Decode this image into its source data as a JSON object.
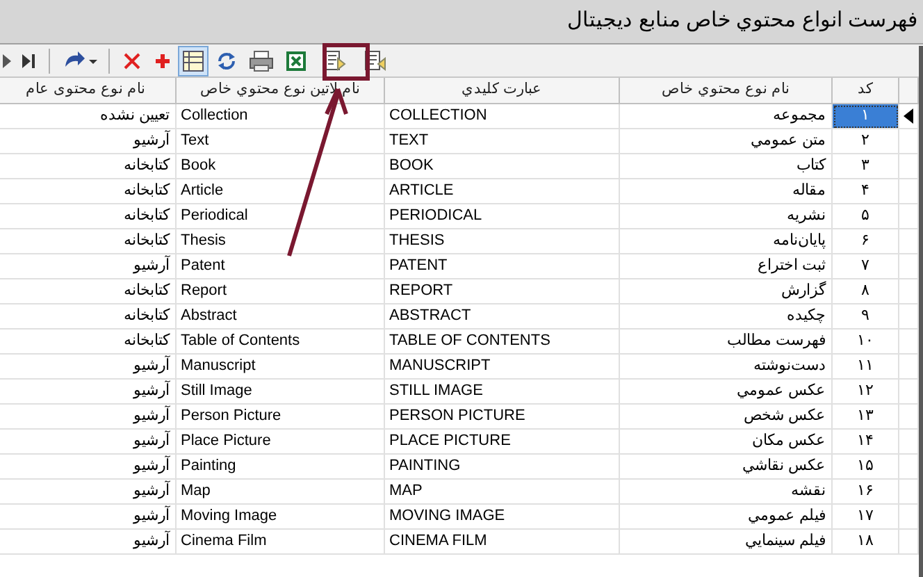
{
  "window": {
    "title": "فهرست انواع محتوي خاص منابع ديجيتال"
  },
  "toolbar": [
    {
      "kind": "next",
      "pressed": false
    },
    {
      "kind": "last",
      "pressed": false
    },
    {
      "kind": "redo",
      "pressed": false
    },
    {
      "kind": "delete",
      "pressed": false
    },
    {
      "kind": "add",
      "pressed": false
    },
    {
      "kind": "grid",
      "pressed": true
    },
    {
      "kind": "refresh",
      "pressed": false
    },
    {
      "kind": "print",
      "pressed": false
    },
    {
      "kind": "excel",
      "pressed": false
    },
    {
      "kind": "export",
      "pressed": false
    },
    {
      "kind": "import",
      "pressed": false
    }
  ],
  "table": {
    "columns": [
      "کد",
      "نام نوع محتوي خاص",
      "عبارت کليدي",
      "نام لاتین نوع محتوي خاص",
      "نام نوع محتوی عام"
    ],
    "rows": [
      {
        "code": "۱",
        "name": "مجموعه",
        "keyword": "COLLECTION",
        "latin": "Collection",
        "general": "تعیین نشده",
        "selected": true
      },
      {
        "code": "۲",
        "name": "متن عمومي",
        "keyword": "TEXT",
        "latin": "Text",
        "general": "آرشیو",
        "selected": false
      },
      {
        "code": "۳",
        "name": "کتاب",
        "keyword": "BOOK",
        "latin": "Book",
        "general": "کتابخانه",
        "selected": false
      },
      {
        "code": "۴",
        "name": "مقاله",
        "keyword": "ARTICLE",
        "latin": "Article",
        "general": "کتابخانه",
        "selected": false
      },
      {
        "code": "۵",
        "name": "نشريه",
        "keyword": "PERIODICAL",
        "latin": "Periodical",
        "general": "کتابخانه",
        "selected": false
      },
      {
        "code": "۶",
        "name": "پايان‌نامه",
        "keyword": "THESIS",
        "latin": "Thesis",
        "general": "کتابخانه",
        "selected": false
      },
      {
        "code": "۷",
        "name": "ثبت اختراع",
        "keyword": "PATENT",
        "latin": "Patent",
        "general": "آرشیو",
        "selected": false
      },
      {
        "code": "۸",
        "name": "گزارش",
        "keyword": "REPORT",
        "latin": "Report",
        "general": "کتابخانه",
        "selected": false
      },
      {
        "code": "۹",
        "name": "چکيده",
        "keyword": "ABSTRACT",
        "latin": "Abstract",
        "general": "کتابخانه",
        "selected": false
      },
      {
        "code": "۱۰",
        "name": "فهرست مطالب",
        "keyword": "TABLE OF CONTENTS",
        "latin": "Table of Contents",
        "general": "کتابخانه",
        "selected": false
      },
      {
        "code": "۱۱",
        "name": "دست‌نوشته",
        "keyword": "MANUSCRIPT",
        "latin": "Manuscript",
        "general": "آرشیو",
        "selected": false
      },
      {
        "code": "۱۲",
        "name": "عکس عمومي",
        "keyword": "STILL IMAGE",
        "latin": "Still Image",
        "general": "آرشیو",
        "selected": false
      },
      {
        "code": "۱۳",
        "name": "عکس شخص",
        "keyword": "PERSON PICTURE",
        "latin": "Person Picture",
        "general": "آرشیو",
        "selected": false
      },
      {
        "code": "۱۴",
        "name": "عکس مکان",
        "keyword": "PLACE PICTURE",
        "latin": "Place Picture",
        "general": "آرشیو",
        "selected": false
      },
      {
        "code": "۱۵",
        "name": "عکس نقاشي",
        "keyword": "PAINTING",
        "latin": "Painting",
        "general": "آرشیو",
        "selected": false
      },
      {
        "code": "۱۶",
        "name": "نقشه",
        "keyword": "MAP",
        "latin": "Map",
        "general": "آرشیو",
        "selected": false
      },
      {
        "code": "۱۷",
        "name": "فيلم عمومي",
        "keyword": "MOVING IMAGE",
        "latin": "Moving Image",
        "general": "آرشیو",
        "selected": false
      },
      {
        "code": "۱۸",
        "name": "فيلم سينمايي",
        "keyword": "CINEMA FILM",
        "latin": "Cinema Film",
        "general": "آرشیو",
        "selected": false
      }
    ]
  }
}
